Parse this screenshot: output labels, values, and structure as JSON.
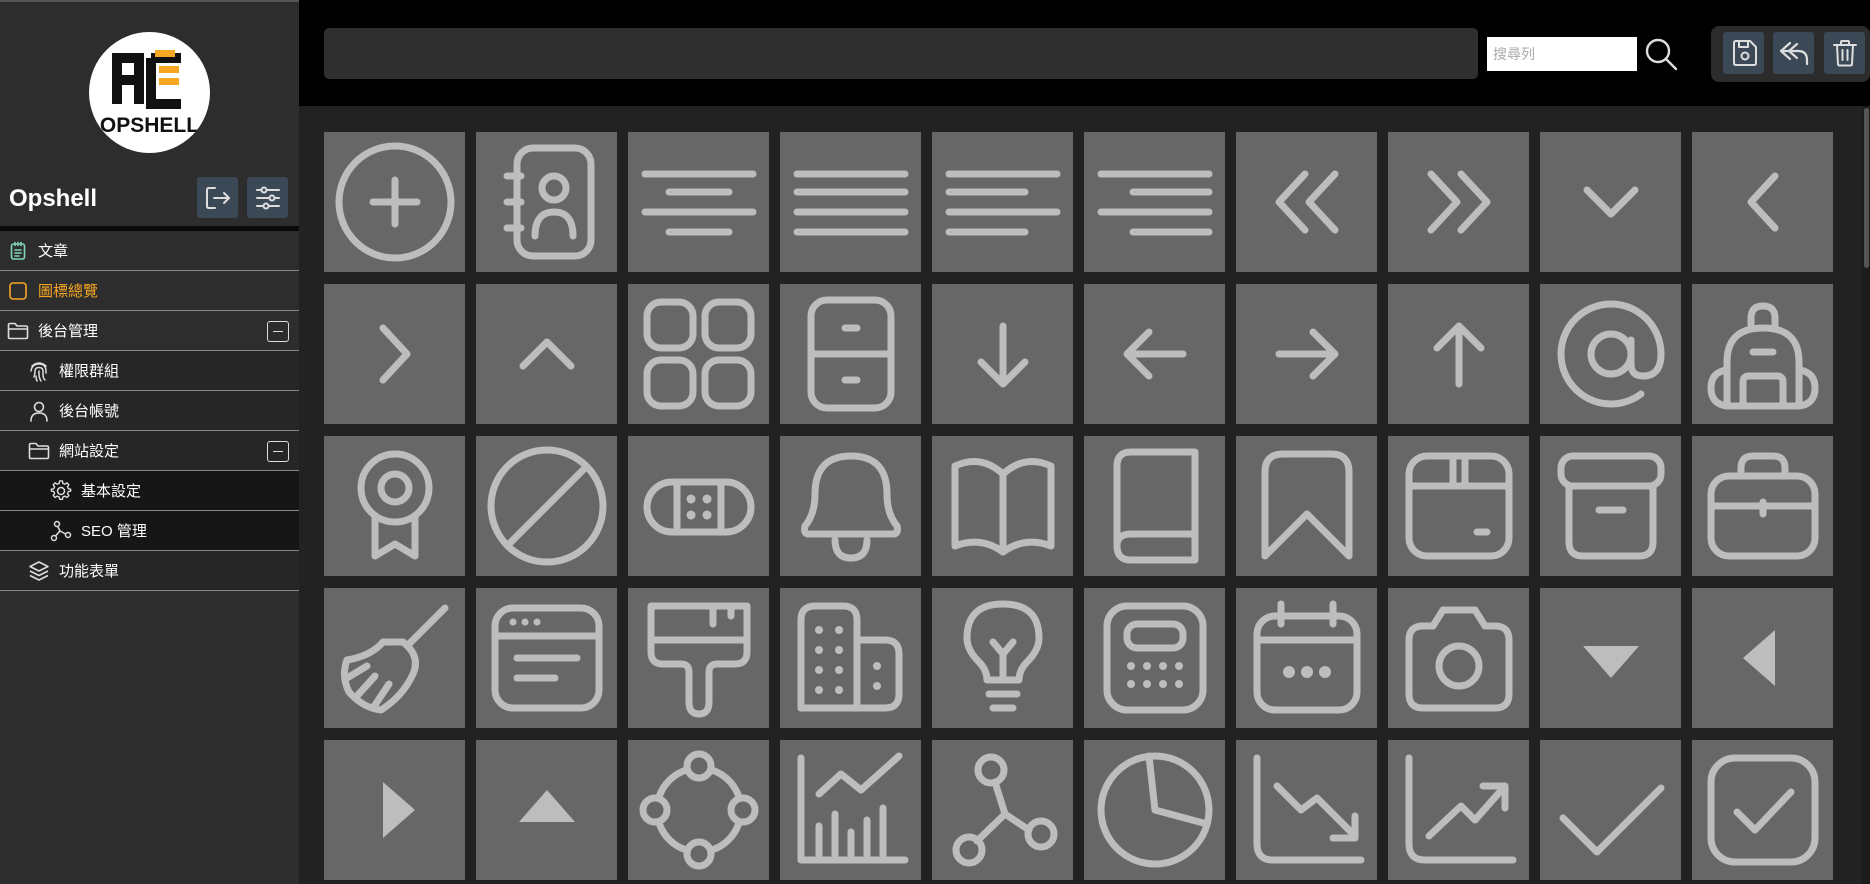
{
  "sidebar": {
    "brand_name": "Opshell",
    "logo_text": "OPSHELL",
    "accent_color": "#f5a623",
    "items": [
      {
        "label": "文章",
        "icon": "notepad-icon",
        "level": 0
      },
      {
        "label": "圖標總覽",
        "icon": "square-icon",
        "level": 0,
        "active": true
      },
      {
        "label": "後台管理",
        "icon": "folder-icon",
        "level": 0,
        "expanded": true
      },
      {
        "label": "權限群組",
        "icon": "fingerprint-icon",
        "level": 1
      },
      {
        "label": "後台帳號",
        "icon": "user-icon",
        "level": 1
      },
      {
        "label": "網站設定",
        "icon": "folder-icon",
        "level": 1,
        "expanded": true
      },
      {
        "label": "基本設定",
        "icon": "gear-icon",
        "level": 2
      },
      {
        "label": "SEO 管理",
        "icon": "network-icon",
        "level": 2
      },
      {
        "label": "功能表單",
        "icon": "layers-icon",
        "level": 1
      }
    ]
  },
  "topbar": {
    "search_placeholder": "搜尋列"
  },
  "icons": [
    "plus-circle-icon",
    "contacts-book-icon",
    "align-center-icon",
    "align-justify-icon",
    "align-left-icon",
    "align-right-icon",
    "chevrons-left-icon",
    "chevrons-right-icon",
    "chevron-down-icon",
    "chevron-left-icon",
    "chevron-right-icon",
    "chevron-up-icon",
    "apps-icon",
    "archive-drawer-icon",
    "arrow-down-icon",
    "arrow-left-icon",
    "arrow-right-icon",
    "arrow-up-icon",
    "at-sign-icon",
    "backpack-icon",
    "badge-icon",
    "ban-icon",
    "bandage-icon",
    "bell-icon",
    "book-open-icon",
    "book-icon",
    "bookmark-icon",
    "box-icon",
    "archive-box-icon",
    "briefcase-icon",
    "broom-icon",
    "browser-icon",
    "brush-icon",
    "buildings-icon",
    "bulb-icon",
    "calculator-icon",
    "calendar-icon",
    "camera-icon",
    "caret-down-icon",
    "caret-left-icon",
    "caret-right-icon",
    "caret-up-icon",
    "circle-nodes-icon",
    "chart-line-icon",
    "molecule-icon",
    "pie-chart-icon",
    "trending-down-icon",
    "trending-up-icon",
    "check-icon",
    "check-square-icon"
  ]
}
